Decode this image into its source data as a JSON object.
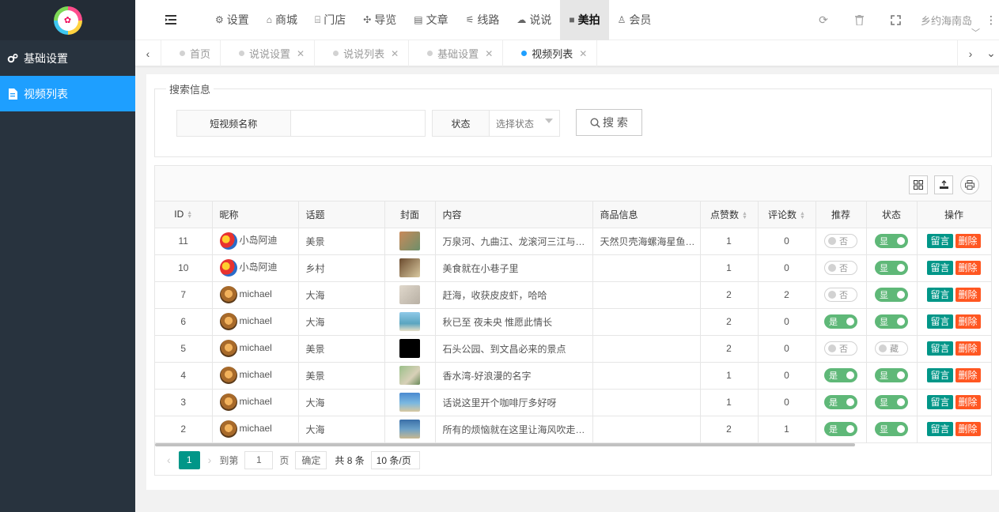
{
  "sidebar": {
    "items": [
      {
        "label": "基础设置",
        "icon": "gears-icon"
      },
      {
        "label": "视频列表",
        "icon": "file-icon"
      }
    ]
  },
  "header": {
    "menu": [
      {
        "label": "设置",
        "icon": "⚙"
      },
      {
        "label": "商城",
        "icon": "⌂"
      },
      {
        "label": "门店",
        "icon": "🏛"
      },
      {
        "label": "导览",
        "icon": "✣"
      },
      {
        "label": "文章",
        "icon": "▤"
      },
      {
        "label": "线路",
        "icon": "⚟"
      },
      {
        "label": "说说",
        "icon": "☁"
      },
      {
        "label": "美拍",
        "icon": "■"
      },
      {
        "label": "会员",
        "icon": "♙"
      }
    ],
    "active_menu": "美拍",
    "user_name": "乡约海南岛"
  },
  "tabs": [
    {
      "label": "首页"
    },
    {
      "label": "说说设置"
    },
    {
      "label": "说说列表"
    },
    {
      "label": "基础设置"
    },
    {
      "label": "视频列表"
    }
  ],
  "search": {
    "legend": "搜索信息",
    "name_label": "短视频名称",
    "name_value": "",
    "status_label": "状态",
    "status_placeholder": "选择状态",
    "button_label": "搜 索"
  },
  "table": {
    "columns": [
      "ID",
      "昵称",
      "话题",
      "封面",
      "内容",
      "商品信息",
      "点赞数",
      "评论数",
      "推荐",
      "状态",
      "操作"
    ],
    "rows": [
      {
        "id": "11",
        "nick": "小岛阿迪",
        "topic": "美景",
        "content": "万泉河、九曲江、龙滚河三江与海…",
        "goods": "天然贝壳海螺海星鱼…",
        "likes": "1",
        "comments": "0",
        "rec": "否",
        "status": "显"
      },
      {
        "id": "10",
        "nick": "小岛阿迪",
        "topic": "乡村",
        "content": "美食就在小巷子里",
        "goods": "",
        "likes": "1",
        "comments": "0",
        "rec": "否",
        "status": "显"
      },
      {
        "id": "7",
        "nick": "michael",
        "topic": "大海",
        "content": "赶海，收获皮皮虾，哈哈",
        "goods": "",
        "likes": "2",
        "comments": "2",
        "rec": "否",
        "status": "显"
      },
      {
        "id": "6",
        "nick": "michael",
        "topic": "大海",
        "content": "秋已至 夜未央 惟愿此情长",
        "goods": "",
        "likes": "2",
        "comments": "0",
        "rec": "是",
        "status": "显"
      },
      {
        "id": "5",
        "nick": "michael",
        "topic": "美景",
        "content": "石头公园、到文昌必来的景点",
        "goods": "",
        "likes": "2",
        "comments": "0",
        "rec": "否",
        "status": "藏"
      },
      {
        "id": "4",
        "nick": "michael",
        "topic": "美景",
        "content": "香水湾-好浪漫的名字",
        "goods": "",
        "likes": "1",
        "comments": "0",
        "rec": "是",
        "status": "显"
      },
      {
        "id": "3",
        "nick": "michael",
        "topic": "大海",
        "content": "话说这里开个咖啡厅多好呀",
        "goods": "",
        "likes": "1",
        "comments": "0",
        "rec": "是",
        "status": "显"
      },
      {
        "id": "2",
        "nick": "michael",
        "topic": "大海",
        "content": "所有的烦恼就在这里让海风吹走吧…",
        "goods": "",
        "likes": "2",
        "comments": "1",
        "rec": "是",
        "status": "显"
      }
    ],
    "action_msg": "留言",
    "action_del": "删除"
  },
  "pager": {
    "current": "1",
    "goto_label": "到第",
    "goto_value": "1",
    "page_unit": "页",
    "confirm": "确定",
    "total": "共 8 条",
    "page_size": "10 条/页"
  },
  "colors": {
    "sidebar_bg": "#28333e",
    "accent_blue": "#1e9fff",
    "green": "#009688",
    "orange": "#ff5722",
    "switch_on": "#5fb878"
  }
}
